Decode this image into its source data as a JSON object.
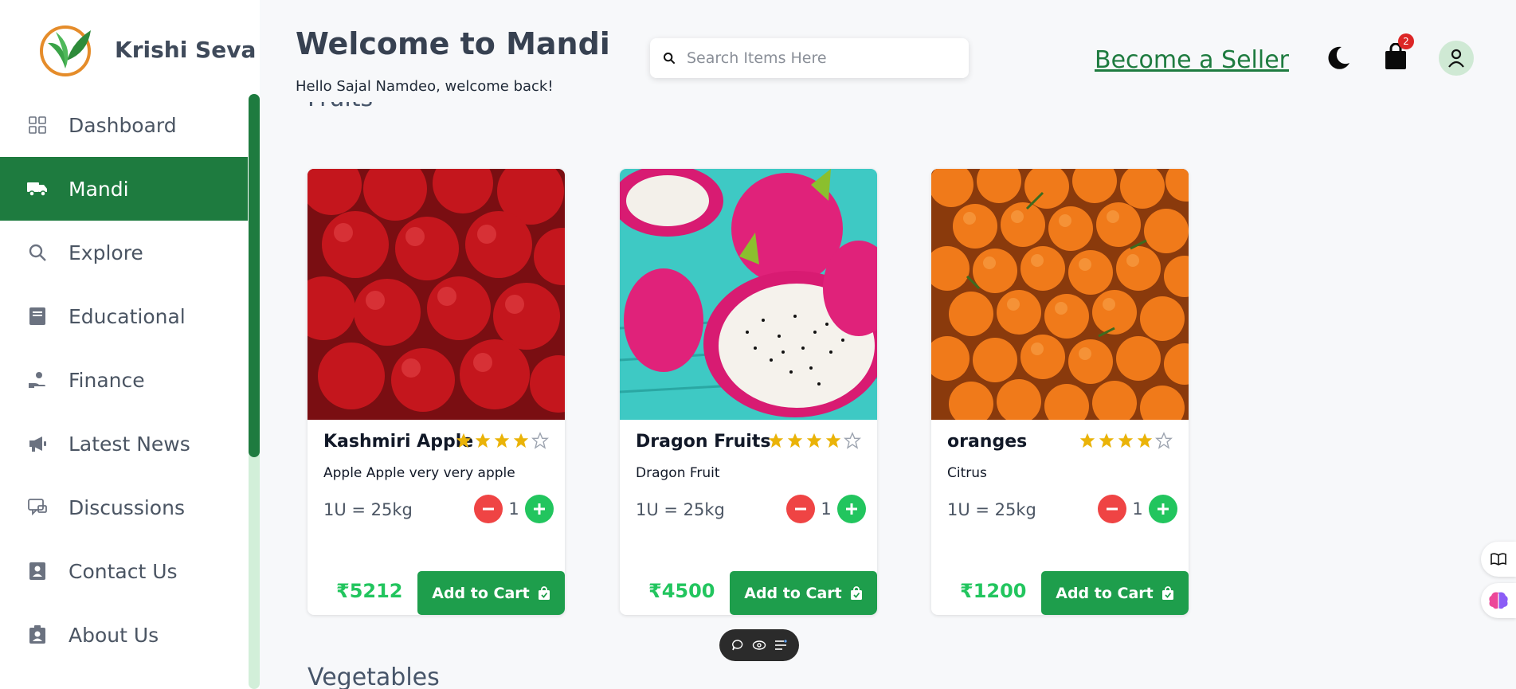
{
  "brand": {
    "name": "Krishi Seva"
  },
  "sidebar": {
    "items": [
      {
        "label": "Dashboard",
        "icon": "grid-icon",
        "active": false
      },
      {
        "label": "Mandi",
        "icon": "truck-icon",
        "active": true
      },
      {
        "label": "Explore",
        "icon": "search-icon",
        "active": false
      },
      {
        "label": "Educational",
        "icon": "book-icon",
        "active": false
      },
      {
        "label": "Finance",
        "icon": "hand-coin-icon",
        "active": false
      },
      {
        "label": "Latest News",
        "icon": "megaphone-icon",
        "active": false
      },
      {
        "label": "Discussions",
        "icon": "chat-icon",
        "active": false
      },
      {
        "label": "Contact Us",
        "icon": "contact-book-icon",
        "active": false
      },
      {
        "label": "About Us",
        "icon": "id-badge-icon",
        "active": false
      }
    ]
  },
  "header": {
    "title": "Welcome to Mandi",
    "subtitle": "Hello Sajal Namdeo, welcome back!",
    "search_placeholder": "Search Items Here",
    "seller_link": "Become a Seller",
    "cart_count": "2"
  },
  "sections": {
    "fruits_heading": "Fruits",
    "vegetables_heading": "Vegetables"
  },
  "products": [
    {
      "name": "Kashmiri Apple",
      "desc": "Apple Apple very very apple",
      "unit": "1U = 25kg",
      "qty": "1",
      "price": "₹5212",
      "rating": 4,
      "add_label": "Add to Cart"
    },
    {
      "name": "Dragon Fruits",
      "desc": "Dragon Fruit",
      "unit": "1U = 25kg",
      "qty": "1",
      "price": "₹4500",
      "rating": 4,
      "add_label": "Add to Cart"
    },
    {
      "name": "oranges",
      "desc": "Citrus",
      "unit": "1U = 25kg",
      "qty": "1",
      "price": "₹1200",
      "rating": 4,
      "add_label": "Add to Cart"
    }
  ],
  "colors": {
    "primary": "#1e7b3f",
    "button": "#1e9e4c",
    "price": "#22c55e",
    "star": "#eab308",
    "minus": "#ef4444",
    "plus": "#22c55e"
  }
}
